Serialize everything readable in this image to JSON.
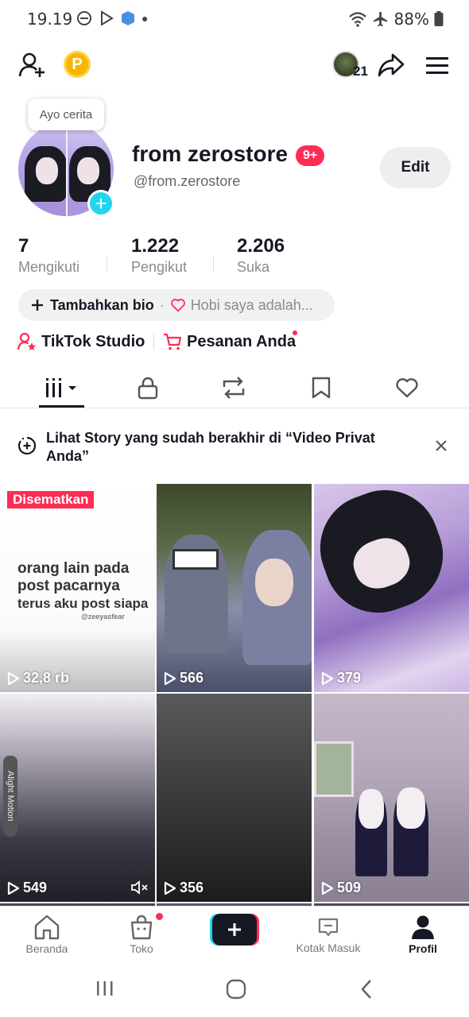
{
  "status_bar": {
    "time": "19.19",
    "battery": "88%"
  },
  "tooltip": "Ayo cerita",
  "top_bar": {
    "coin_letter": "P",
    "friends_count": "21"
  },
  "profile": {
    "name": "from zerostore",
    "badge": "9+",
    "handle": "@from.zerostore",
    "edit_label": "Edit"
  },
  "stats": [
    {
      "value": "7",
      "label": "Mengikuti"
    },
    {
      "value": "1.222",
      "label": "Pengikut"
    },
    {
      "value": "2.206",
      "label": "Suka"
    }
  ],
  "bio": {
    "add_label": "Tambahkan bio",
    "hint": "Hobi saya adalah..."
  },
  "links": {
    "studio": "TikTok Studio",
    "orders": "Pesanan Anda"
  },
  "banner": {
    "text": "Lihat Story yang sudah berakhir di “Video Privat Anda”"
  },
  "videos": [
    {
      "views": "32,8 rb",
      "pinned_label": "Disematkan",
      "caption_line1": "orang lain pada",
      "caption_line2": "post pacarnya",
      "caption_line3": "terus aku post siapa",
      "watermark": "@zeeyasfear"
    },
    {
      "views": "566"
    },
    {
      "views": "379"
    },
    {
      "views": "549",
      "side_label": "Alight Motion"
    },
    {
      "views": "356"
    },
    {
      "views": "509"
    }
  ],
  "bottom_nav": [
    {
      "label": "Beranda"
    },
    {
      "label": "Toko"
    },
    {
      "label": "Kotak Masuk"
    },
    {
      "label": "Profil"
    }
  ],
  "colors": {
    "accent": "#fe2c55",
    "cyan": "#20d5ec",
    "coin": "#f7b500"
  }
}
